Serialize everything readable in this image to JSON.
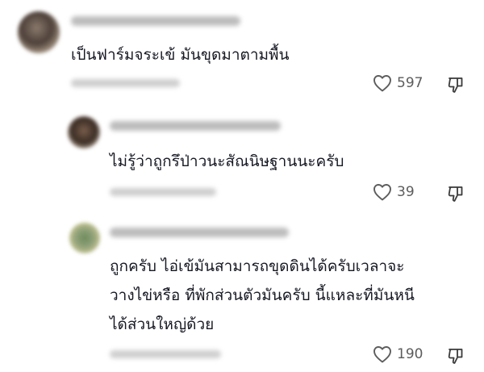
{
  "comments": [
    {
      "text_lines": [
        "เป็นฟาร์มจระเข้ มันขุดมาตามพื้น"
      ],
      "likes": "597"
    },
    {
      "text_lines": [
        "ไม่รู้ว่าถูกรึป่าวนะสัณนิษฐานนะครับ"
      ],
      "likes": "39"
    },
    {
      "text_lines": [
        "ถูกครับ ไอ่เข้มันสามารถขุดดินได้ครับเวลาจะ",
        "วางไข่หรือ ที่พักส่วนตัวมันครับ นี้แหละที่มันหนี",
        "ได้ส่วนใหญ่ด้วย"
      ],
      "likes": "190"
    }
  ],
  "icons": {
    "like": "heart-icon",
    "dislike": "thumbs-down-icon"
  }
}
